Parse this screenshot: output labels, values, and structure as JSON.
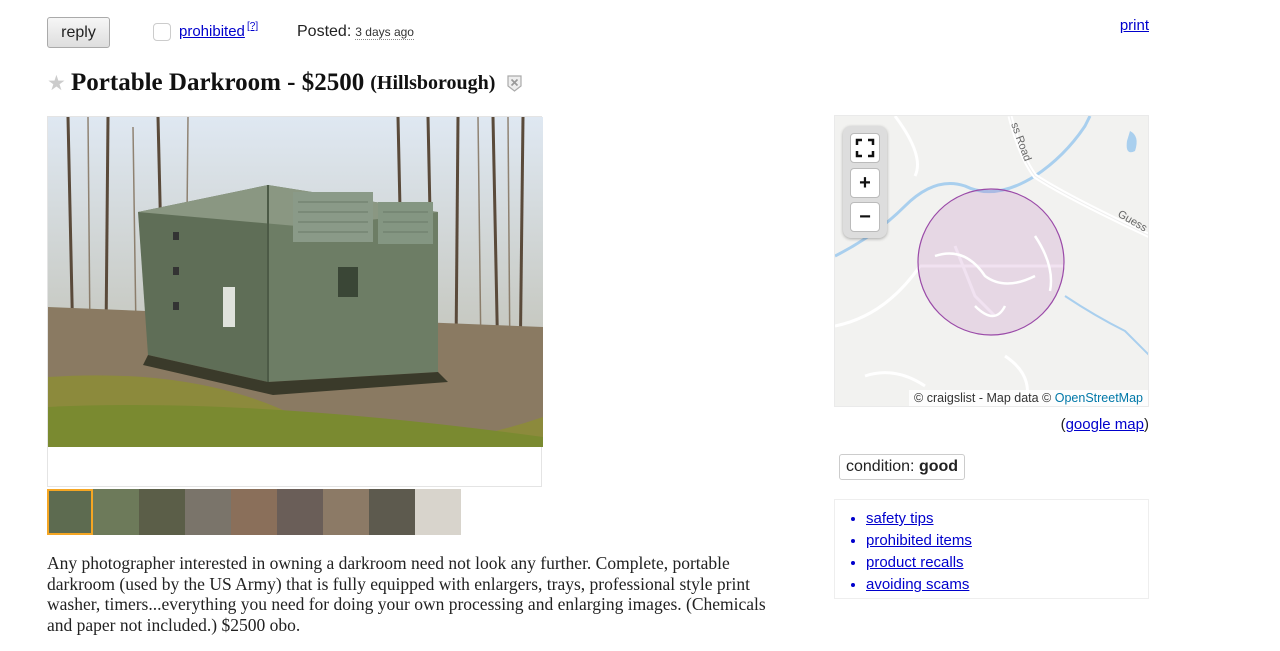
{
  "topbar": {
    "reply_label": "reply",
    "prohibited_label": "prohibited",
    "prohibited_count": "[?]",
    "posted_label": "Posted:",
    "posted_time": "3 days ago",
    "print_label": "print"
  },
  "posting": {
    "title": "Portable Darkroom - $2500",
    "location": "(Hillsborough)",
    "description": "Any photographer interested in owning a darkroom need not look any further. Complete, portable darkroom (used by the US Army) that is fully equipped with enlargers, trays, professional style print washer, timers...everything you need for doing your own processing and enlarging images. (Chemicals and paper not included.) $2500 obo."
  },
  "thumbnails": [
    {
      "color": "#5d6b50"
    },
    {
      "color": "#6d7a5a"
    },
    {
      "color": "#5b5e48"
    },
    {
      "color": "#7a746a"
    },
    {
      "color": "#8a6f5a"
    },
    {
      "color": "#6a5e58"
    },
    {
      "color": "#8c7a66"
    },
    {
      "color": "#5d5a4e"
    },
    {
      "color": "#d8d4cc"
    }
  ],
  "map": {
    "zoom_in": "+",
    "zoom_out": "−",
    "road_label_1": "ss Road",
    "road_label_2": "Guess R",
    "attribution_prefix": "© craigslist - Map data ©",
    "attribution_link": "OpenStreetMap",
    "google_map_label": "google map"
  },
  "attributes": {
    "condition_label": "condition:",
    "condition_value": "good"
  },
  "safety_links": [
    "safety tips",
    "prohibited items",
    "product recalls",
    "avoiding scams"
  ],
  "colors": {
    "link": "#0000cc",
    "accent_thumb_border": "#f5a623",
    "map_circle": "#b060b0"
  }
}
